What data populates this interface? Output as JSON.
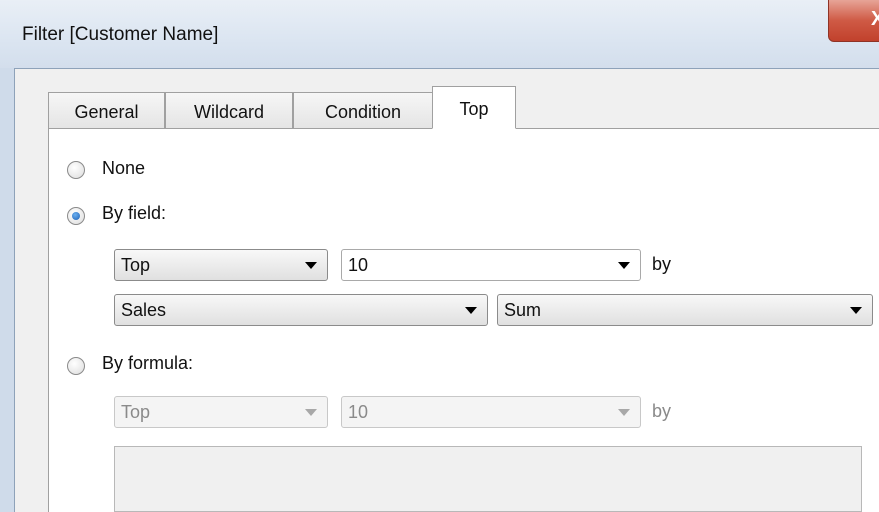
{
  "window": {
    "title": "Filter [Customer Name]",
    "close_glyph": "X"
  },
  "tabs": [
    {
      "label": "General",
      "active": false
    },
    {
      "label": "Wildcard",
      "active": false
    },
    {
      "label": "Condition",
      "active": false
    },
    {
      "label": "Top",
      "active": true
    }
  ],
  "options": {
    "none": {
      "label": "None",
      "selected": false
    },
    "by_field": {
      "label": "By field:",
      "selected": true,
      "direction": "Top",
      "count": "10",
      "by_label": "by",
      "field": "Sales",
      "aggregation": "Sum"
    },
    "by_formula": {
      "label": "By formula:",
      "selected": false,
      "direction": "Top",
      "count": "10",
      "by_label": "by"
    }
  },
  "colors": {
    "frame": "#cfdbea",
    "close_button": "#c1412c",
    "radio_selected": "#1c5fb5"
  }
}
